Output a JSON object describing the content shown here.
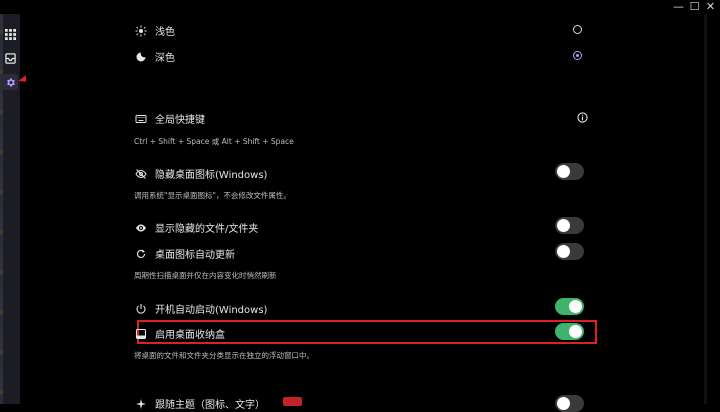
{
  "window": {
    "controls": [
      "—",
      "☐",
      "✕"
    ]
  },
  "sidebar": {
    "items": [
      {
        "name": "apps",
        "icon": "grid-icon"
      },
      {
        "name": "desktop",
        "icon": "tray-icon"
      },
      {
        "name": "settings",
        "icon": "gear-icon",
        "active": true
      }
    ]
  },
  "theme": {
    "light_label": "浅色",
    "dark_label": "深色",
    "selected": "dark"
  },
  "hotkey": {
    "label": "全局快捷键",
    "value": "Ctrl + Shift + Space 或 Alt + Shift + Space",
    "info_icon": "info-icon"
  },
  "settings": {
    "hide_icons": {
      "label": "隐藏桌面图标(Windows)",
      "desc": "调用系统\"显示桌面图标\"，不会修改文件属性。",
      "enabled": false
    },
    "show_hidden": {
      "label": "显示隐藏的文件/文件夹",
      "enabled": false
    },
    "auto_refresh": {
      "label": "桌面图标自动更新",
      "desc": "周期性扫描桌面并仅在内容变化时悄然刷新",
      "enabled": false
    },
    "autostart": {
      "label": "开机自动启动(Windows)",
      "enabled": true
    },
    "desktop_box": {
      "label": "启用桌面收纳盒",
      "desc": "将桌面的文件和文件夹分类显示在独立的浮动窗口中。",
      "enabled": true
    },
    "partial_next": {
      "label": "跟随主题（图标、文字）"
    }
  },
  "colors": {
    "accent": "#b79bff",
    "toggle_on": "#3db36b",
    "highlight": "#e02020"
  }
}
